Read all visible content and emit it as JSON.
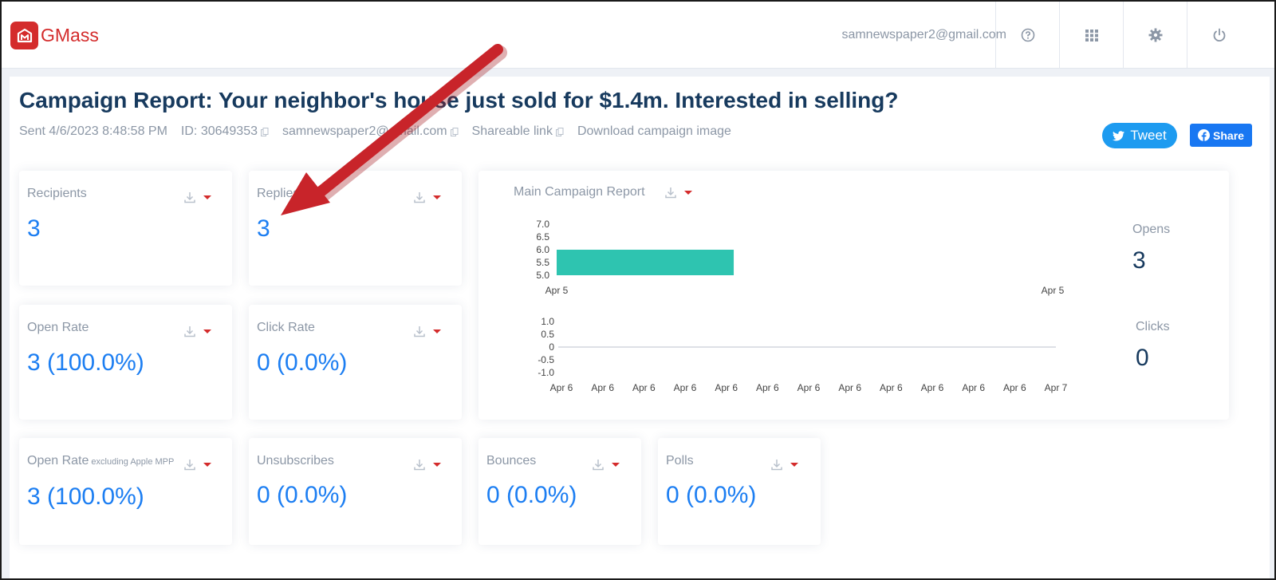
{
  "app": {
    "name": "GMass"
  },
  "header": {
    "user_email": "samnewspaper2@gmail.com",
    "buttons": [
      "help-icon",
      "apps-grid-icon",
      "gear-icon",
      "power-icon"
    ]
  },
  "report": {
    "title": "Campaign Report: Your neighbor's house just sold for $1.4m. Interested in selling?",
    "sent": "Sent 4/6/2023 8:48:58 PM",
    "id": "ID: 30649353",
    "sender": "samnewspaper2@gmail.com",
    "shareable_link": "Shareable link",
    "download_image": "Download campaign image"
  },
  "social": {
    "tweet": "Tweet",
    "share": "Share"
  },
  "colors": {
    "brand": "#d42c2c",
    "value_blue": "#1c7ef2",
    "title_navy": "#173a5e",
    "bar_teal": "#2ec4b0",
    "annotation_red": "#c8242a"
  },
  "cards": {
    "recipients": {
      "label": "Recipients",
      "value": "3"
    },
    "replies": {
      "label": "Replies",
      "value": "3"
    },
    "open_rate": {
      "label": "Open Rate",
      "value": "3 (100.0%)"
    },
    "click_rate": {
      "label": "Click Rate",
      "value": "0 (0.0%)"
    },
    "open_rate_mpp": {
      "label": "Open Rate",
      "sublabel": "excluding Apple MPP",
      "value": "3 (100.0%)"
    },
    "unsubscribes": {
      "label": "Unsubscribes",
      "value": "0 (0.0%)"
    },
    "bounces": {
      "label": "Bounces",
      "value": "0 (0.0%)"
    },
    "polls": {
      "label": "Polls",
      "value": "0 (0.0%)"
    }
  },
  "main_chart": {
    "title": "Main Campaign Report",
    "opens_label": "Opens",
    "opens_value": "3",
    "clicks_label": "Clicks",
    "clicks_value": "0"
  },
  "chart_data": [
    {
      "type": "bar",
      "title": "",
      "x_ticks": [
        "Apr 5",
        "Apr 5"
      ],
      "y_ticks": [
        "7.0",
        "6.5",
        "6.0",
        "5.5",
        "5.0"
      ],
      "ylim": [
        5.0,
        7.0
      ],
      "series": [
        {
          "values": [
            6.0
          ],
          "x_start": "Apr 5",
          "fraction_of_axis": 0.357
        }
      ],
      "grid": false
    },
    {
      "type": "line",
      "title": "",
      "x_ticks": [
        "Apr 6",
        "Apr 6",
        "Apr 6",
        "Apr 6",
        "Apr 6",
        "Apr 6",
        "Apr 6",
        "Apr 6",
        "Apr 6",
        "Apr 6",
        "Apr 6",
        "Apr 6",
        "Apr 7"
      ],
      "y_ticks": [
        "1.0",
        "0.5",
        "0",
        "-0.5",
        "-1.0"
      ],
      "ylim": [
        -1.0,
        1.0
      ],
      "series": [
        {
          "values": [
            0,
            0
          ]
        }
      ],
      "grid": false
    }
  ]
}
